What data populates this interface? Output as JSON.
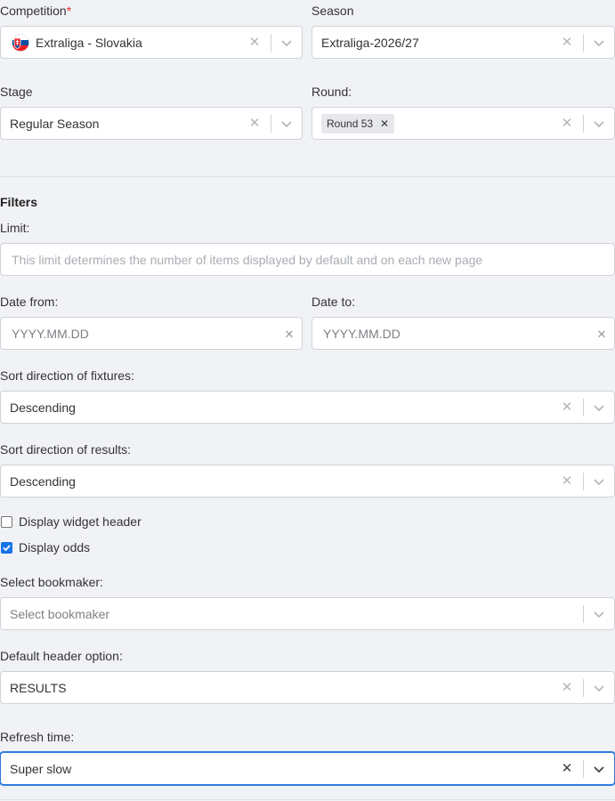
{
  "competition": {
    "label": "Competition",
    "required_mark": "*",
    "value": "Extraliga - Slovakia",
    "flag_icon": "slovakia-flag-icon"
  },
  "season": {
    "label": "Season",
    "value": "Extraliga-2026/27"
  },
  "stage": {
    "label": "Stage",
    "value": "Regular Season"
  },
  "round": {
    "label": "Round:",
    "tag": "Round 53"
  },
  "filters": {
    "title": "Filters",
    "limit": {
      "label": "Limit:",
      "placeholder": "This limit determines the number of items displayed by default and on each new page"
    },
    "date_from": {
      "label": "Date from:",
      "placeholder": "YYYY.MM.DD"
    },
    "date_to": {
      "label": "Date to:",
      "placeholder": "YYYY.MM.DD"
    },
    "sort_fixtures": {
      "label": "Sort direction of fixtures:",
      "value": "Descending"
    },
    "sort_results": {
      "label": "Sort direction of results:",
      "value": "Descending"
    },
    "display_header": {
      "label": "Display widget header",
      "checked": false
    },
    "display_odds": {
      "label": "Display odds",
      "checked": true
    },
    "bookmaker": {
      "label": "Select bookmaker:",
      "placeholder": "Select bookmaker"
    },
    "default_header": {
      "label": "Default header option:",
      "value": "RESULTS"
    },
    "refresh_time": {
      "label": "Refresh time:",
      "value": "Super slow"
    }
  },
  "colors": {
    "background": "#f0f2f5",
    "accent": "#2f7de1",
    "required": "#e03030",
    "checkbox": "#1a73e8"
  }
}
